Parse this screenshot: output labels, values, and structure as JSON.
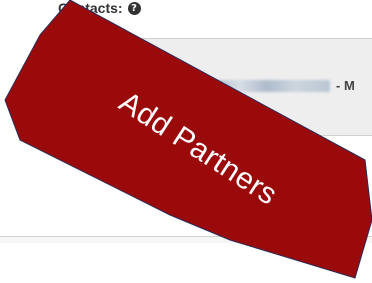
{
  "contacts": {
    "label": "Contacts:",
    "help_icon": "question-circle-icon",
    "entry_suffix": "- M"
  },
  "callout": {
    "text": "Add Partners",
    "color": "#9b0a0a",
    "text_color": "#ffffff"
  }
}
